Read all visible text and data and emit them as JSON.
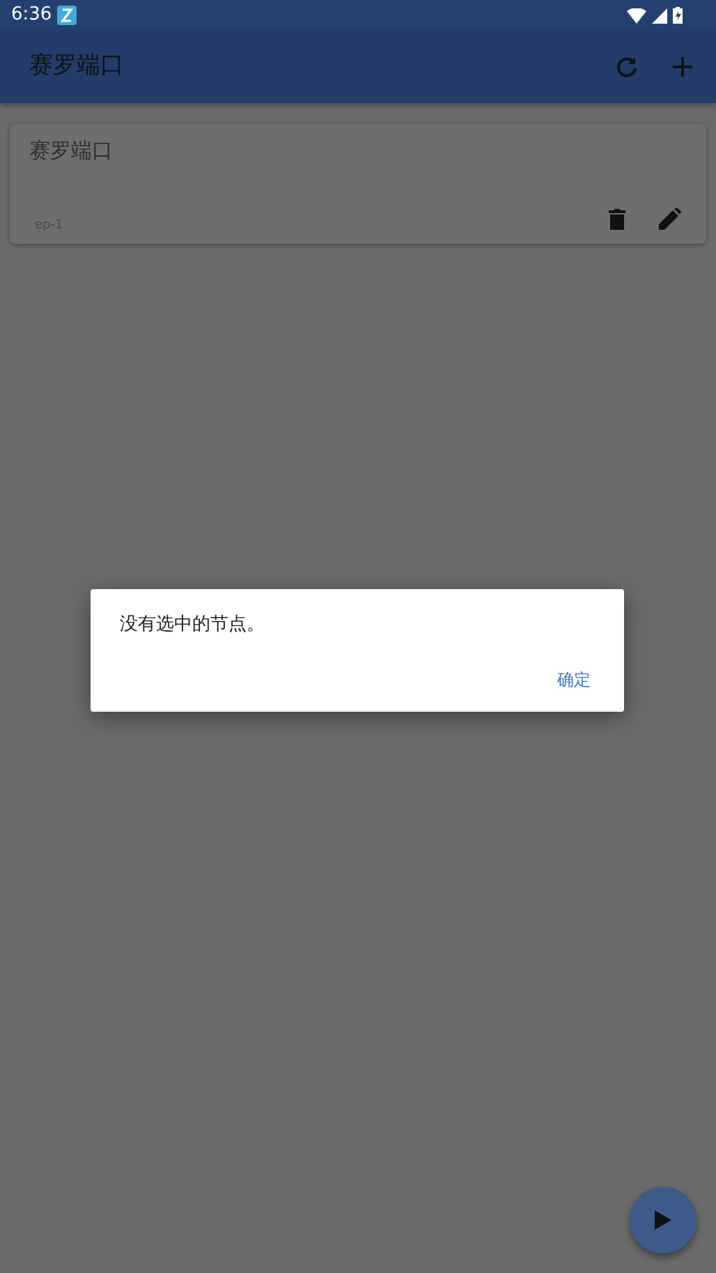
{
  "status_bar": {
    "time": "6:36"
  },
  "app_bar": {
    "title": "赛罗端口"
  },
  "cards": [
    {
      "title": "赛罗端口",
      "subtitle": "ep-1"
    }
  ],
  "dialog": {
    "message": "没有选中的节点。",
    "buttons": [
      "确定"
    ]
  }
}
